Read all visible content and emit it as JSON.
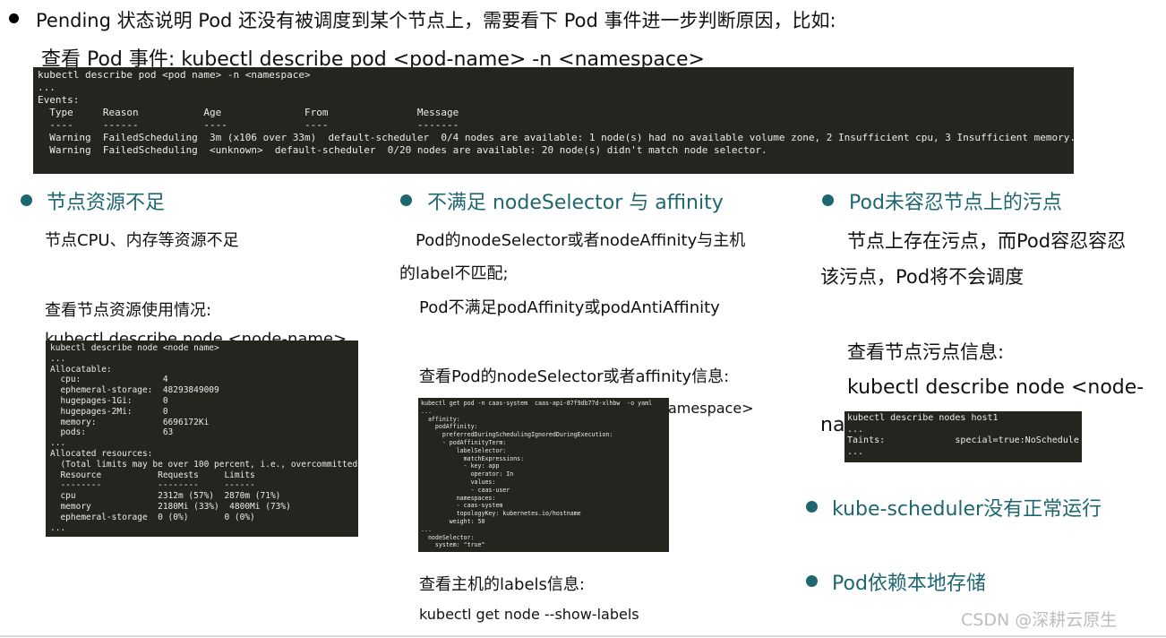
{
  "header": {
    "intro": "Pending 状态说明 Pod 还没有被调度到某个节点上，需要看下 Pod 事件进一步判断原因，比如:",
    "cmd_line": "查看 Pod 事件: kubectl describe pod <pod-name> -n <namespace>"
  },
  "events_terminal": {
    "lines": [
      "kubectl describe pod <pod name> -n <namespace>",
      "...",
      "Events:",
      "  Type     Reason           Age              From               Message",
      "  ----     ------           ----             ----               -------",
      "  Warning  FailedScheduling  3m (x106 over 33m)  default-scheduler  0/4 nodes are available: 1 node(s) had no available volume zone, 2 Insufficient cpu, 3 Insufficient memory.",
      "",
      "  Warning  FailedScheduling  <unknown>  default-scheduler  0/20 nodes are available: 20 node(s) didn't match node selector."
    ]
  },
  "col1": {
    "title": "节点资源不足",
    "desc": "节点CPU、内存等资源不足",
    "check": "查看节点资源使用情况:",
    "cmd_partial": "kubectl describe node <node-name>",
    "terminal_lines": [
      "kubectl describe node <node name>",
      "...",
      "Allocatable:",
      "  cpu:                4",
      "  ephemeral-storage:  48293849009",
      "  hugepages-1Gi:      0",
      "  hugepages-2Mi:      0",
      "  memory:             6696172Ki",
      "  pods:               63",
      "...",
      "Allocated resources:",
      "  (Total limits may be over 100 percent, i.e., overcommitted.)",
      "  Resource           Requests     Limits",
      "  --------           --------     ------",
      "  cpu                2312m (57%)  2870m (71%)",
      "  memory             2180Mi (33%)  4800Mi (73%)",
      "  ephemeral-storage  0 (0%)       0 (0%)",
      "..."
    ]
  },
  "col2": {
    "title": "不满足 nodeSelector 与 affinity",
    "desc1a": " Pod的nodeSelector或者nodeAffinity与主机",
    "desc1b": "的label不匹配;",
    "desc2": "Pod不满足podAffinity或podAntiAffinity",
    "check": "查看Pod的nodeSelector或者affinity信息:",
    "cmd_tail": "amespace>",
    "terminal_lines": [
      "kubectl get pod -n caas-system  caas-api-87f9db77d-xlhbw  -o yaml",
      "...",
      "  affinity:",
      "    podAffinity:",
      "      preferredDuringSchedulingIgnoredDuringExecution:",
      "      - podAffinityTerm:",
      "          labelSelector:",
      "            matchExpressions:",
      "            - key: app",
      "              operator: In",
      "              values:",
      "              - caas-user",
      "          namespaces:",
      "          - caas-system",
      "          topologyKey: kubernetes.io/hostname",
      "        weight: 50",
      "...",
      "  nodeSelector:",
      "    system: \"true\""
    ],
    "labels_check": "查看主机的labels信息:",
    "labels_cmd": "kubectl get node --show-labels"
  },
  "col3": {
    "title": "Pod未容忍节点上的污点",
    "desc1": "节点上存在污点，而Pod容忍容忍",
    "desc2": "该污点，Pod将不会调度",
    "check": "查看节点污点信息:",
    "cmd1": "kubectl describe node <node-",
    "cmd2_partial": "na",
    "terminal_lines": [
      "kubectl describe nodes host1",
      "...",
      "Taints:             special=true:NoSchedule",
      "..."
    ],
    "bullet2": "kube-scheduler没有正常运行",
    "bullet3": "Pod依赖本地存储"
  },
  "watermark": "CSDN @深耕云原生"
}
